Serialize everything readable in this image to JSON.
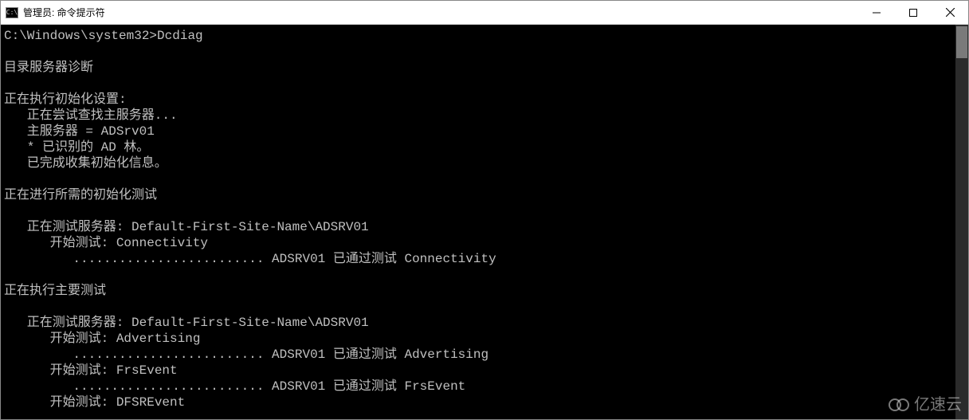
{
  "window": {
    "title": "管理员: 命令提示符",
    "icon_label": "C:\\"
  },
  "console": {
    "lines": [
      "C:\\Windows\\system32>Dcdiag",
      "",
      "目录服务器诊断",
      "",
      "正在执行初始化设置:",
      "   正在尝试查找主服务器...",
      "   主服务器 = ADSrv01",
      "   * 已识别的 AD 林。",
      "   已完成收集初始化信息。",
      "",
      "正在进行所需的初始化测试",
      "",
      "   正在测试服务器: Default-First-Site-Name\\ADSRV01",
      "      开始测试: Connectivity",
      "         ......................... ADSRV01 已通过测试 Connectivity",
      "",
      "正在执行主要测试",
      "",
      "   正在测试服务器: Default-First-Site-Name\\ADSRV01",
      "      开始测试: Advertising",
      "         ......................... ADSRV01 已通过测试 Advertising",
      "      开始测试: FrsEvent",
      "         ......................... ADSRV01 已通过测试 FrsEvent",
      "      开始测试: DFSREvent"
    ]
  },
  "watermark": {
    "text": "亿速云"
  }
}
